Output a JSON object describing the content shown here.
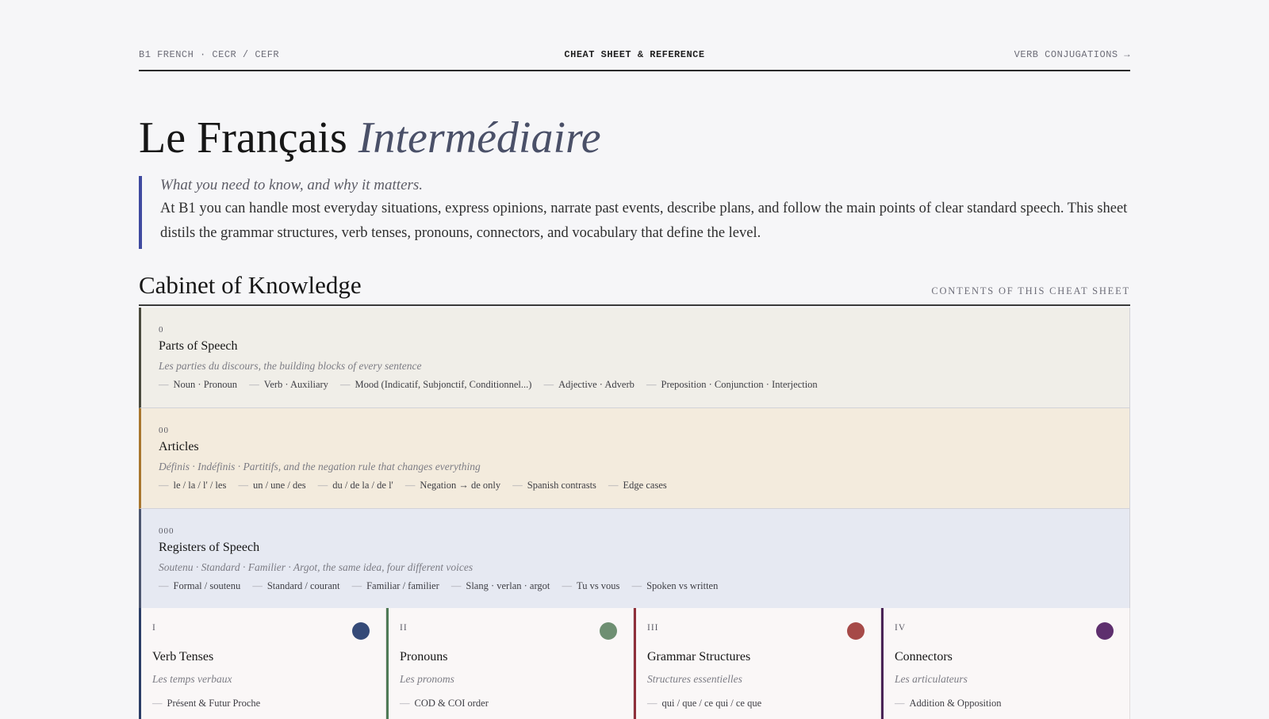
{
  "topbar": {
    "left": "B1 FRENCH · CECR / CEFR",
    "center": "CHEAT SHEET & REFERENCE",
    "right": "VERB CONJUGATIONS →"
  },
  "title": {
    "main": "Le Français",
    "italic": "Intermédiaire"
  },
  "lead": {
    "kicker": "What you need to know, and why it matters.",
    "body": "At B1 you can handle most everyday situations, express opinions, narrate past events, describe plans, and follow the main points of clear standard speech. This sheet distils the grammar structures, verb tenses, pronouns, connectors, and vocabulary that define the level."
  },
  "section": {
    "title": "Cabinet of Knowledge",
    "meta": "CONTENTS OF THIS CHEAT SHEET"
  },
  "rows": [
    {
      "num": "0",
      "name": "Parts of Speech",
      "desc": "Les parties du discours, the building blocks of every sentence",
      "tags": [
        "Noun · Pronoun",
        "Verb · Auxiliary",
        "Mood (Indicatif, Subjonctif, Conditionnel...)",
        "Adjective · Adverb",
        "Preposition · Conjunction · Interjection"
      ],
      "bg": "#f0eee8",
      "accent": "#4a4a3e"
    },
    {
      "num": "00",
      "name": "Articles",
      "desc": "Définis · Indéfinis · Partitifs, and the negation rule that changes everything",
      "tags": [
        "le / la / l' / les",
        "un / une / des",
        "du / de la / de l'",
        "Negation → de only",
        "Spanish contrasts",
        "Edge cases"
      ],
      "bg": "#f3ebdd",
      "accent": "#a8762e"
    },
    {
      "num": "000",
      "name": "Registers of Speech",
      "desc": "Soutenu · Standard · Familier · Argot, the same idea, four different voices",
      "tags": [
        "Formal / soutenu",
        "Standard / courant",
        "Familiar / familier",
        "Slang · verlan · argot",
        "Tu vs vous",
        "Spoken vs written"
      ],
      "bg": "#e6e9f2",
      "accent": "#4d5670"
    }
  ],
  "cards": [
    {
      "roman": "I",
      "name": "Verb Tenses",
      "sub": "Les temps verbaux",
      "item": "Présent & Futur Proche",
      "color": "#354a78",
      "accent": "#2b3d66"
    },
    {
      "roman": "II",
      "name": "Pronouns",
      "sub": "Les pronoms",
      "item": "COD & COI order",
      "color": "#6e8f72",
      "accent": "#4f7a56"
    },
    {
      "roman": "III",
      "name": "Grammar Structures",
      "sub": "Structures essentielles",
      "item": "qui / que / ce qui / ce que",
      "color": "#a64a48",
      "accent": "#8e2f3a"
    },
    {
      "roman": "IV",
      "name": "Connectors",
      "sub": "Les articulateurs",
      "item": "Addition & Opposition",
      "color": "#5e2f6e",
      "accent": "#4a2457"
    }
  ]
}
